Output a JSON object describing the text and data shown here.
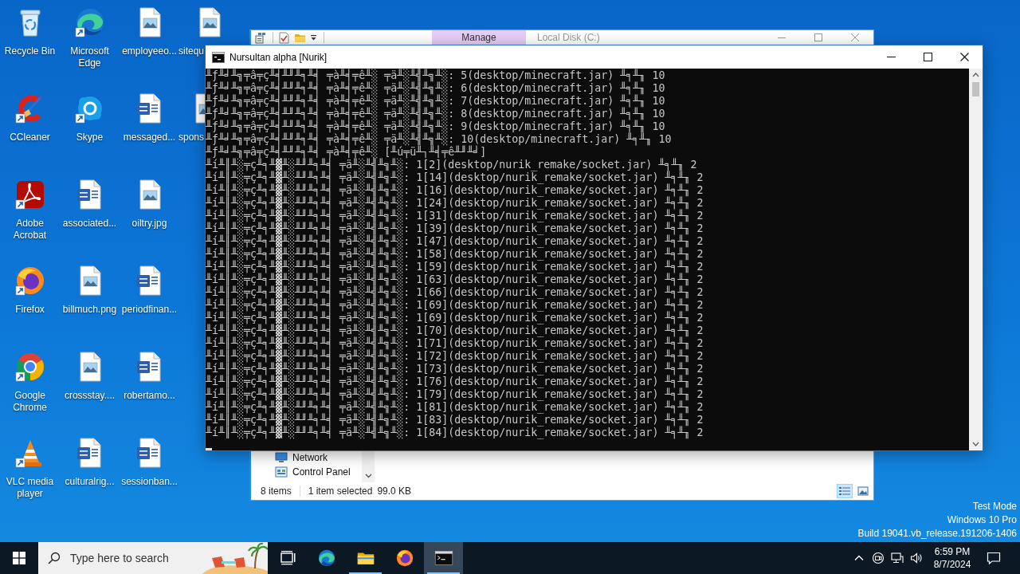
{
  "desktop": {
    "icons": [
      {
        "label": "Recycle Bin",
        "kind": "recycle-bin",
        "shortcut": false
      },
      {
        "label": "CCleaner",
        "kind": "ccleaner",
        "shortcut": true
      },
      {
        "label": "Adobe Acrobat",
        "kind": "acrobat",
        "shortcut": true
      },
      {
        "label": "Firefox",
        "kind": "firefox",
        "shortcut": true
      },
      {
        "label": "Google Chrome",
        "kind": "chrome",
        "shortcut": true
      },
      {
        "label": "VLC media player",
        "kind": "vlc",
        "shortcut": true
      },
      {
        "label": "Microsoft Edge",
        "kind": "edge",
        "shortcut": true
      },
      {
        "label": "Skype",
        "kind": "skype",
        "shortcut": true
      },
      {
        "label": "associated...",
        "kind": "word-doc",
        "shortcut": false
      },
      {
        "label": "billmuch.png",
        "kind": "image-file",
        "shortcut": false
      },
      {
        "label": "crossstay....",
        "kind": "image-file",
        "shortcut": false
      },
      {
        "label": "culturalrig...",
        "kind": "word-doc",
        "shortcut": false
      },
      {
        "label": "employeeo...",
        "kind": "image-file",
        "shortcut": false
      },
      {
        "label": "messaged...",
        "kind": "word-doc",
        "shortcut": false
      },
      {
        "label": "oiltry.jpg",
        "kind": "image-file",
        "shortcut": false
      },
      {
        "label": "periodfinan...",
        "kind": "word-doc",
        "shortcut": false
      },
      {
        "label": "robertamo...",
        "kind": "word-doc",
        "shortcut": false
      },
      {
        "label": "sessionban...",
        "kind": "word-doc",
        "shortcut": false
      },
      {
        "label": "sitequ",
        "kind": "image-file",
        "shortcut": false
      },
      {
        "label": "spons",
        "kind": "image-file",
        "shortcut": false
      }
    ],
    "system_notice": [
      "Test Mode",
      "Windows 10 Pro",
      "Build 19041.vb_release.191206-1406"
    ]
  },
  "explorer_window": {
    "ribbon_tab": "Manage",
    "title": "Local Disk (C:)",
    "nav_items": [
      {
        "label": "Network",
        "kind": "network"
      },
      {
        "label": "Control Panel",
        "kind": "control-panel"
      }
    ],
    "status": {
      "item_count": "8 items",
      "selection": "1 item selected",
      "size": "99.0 KB"
    },
    "view_buttons": [
      {
        "kind": "details",
        "selected": true
      },
      {
        "kind": "large-icons",
        "selected": false
      }
    ]
  },
  "console_window": {
    "title": "Nursultan alpha [Nurik]",
    "lines": [
      "╨ƒ╨╛╨╗╤â╤ç╨╡╨╜╨╕╨╡ ╤à╨╡╤ê╨░ ╤ä╨░╨╣╨╗╨░: 5(desktop/minecraft.jar) ╨╕╨╖ 10",
      "╨ƒ╨╛╨╗╤â╤ç╨╡╨╜╨╕╨╡ ╤à╨╡╤ê╨░ ╤ä╨░╨╣╨╗╨░: 6(desktop/minecraft.jar) ╨╕╨╖ 10",
      "╨ƒ╨╛╨╗╤â╤ç╨╡╨╜╨╕╨╡ ╤à╨╡╤ê╨░ ╤ä╨░╨╣╨╗╨░: 7(desktop/minecraft.jar) ╨╕╨╖ 10",
      "╨ƒ╨╛╨╗╤â╤ç╨╡╨╜╨╕╨╡ ╤à╨╡╤ê╨░ ╤ä╨░╨╣╨╗╨░: 8(desktop/minecraft.jar) ╨╕╨╖ 10",
      "╨ƒ╨╛╨╗╤â╤ç╨╡╨╜╨╕╨╡ ╤à╨╡╤ê╨░ ╤ä╨░╨╣╨╗╨░: 9(desktop/minecraft.jar) ╨╕╨╖ 10",
      "╨ƒ╨╛╨╗╤â╤ç╨╡╨╜╨╕╨╡ ╤à╨╡╤ê╨░ ╤ä╨░╨╣╨╗╨░: 10(desktop/minecraft.jar) ╨╕╨╖ 10",
      "╨ƒ╨╛╨╗╤â╤ç╨╡╨╜╨╕╨╡ ╤à╨╡╤ê╨░ [╨ú╤ü╨┐╨╡╤ê╨╜╨╛]",
      "╨í╨║╨░╤ç╨╕╨▓╨░╨╜╨╕╨╡ ╤ä╨░╨╣╨╗╨░: 1[2](desktop/nurik_remake/socket.jar) ╨╕╨╖ 2",
      "╨í╨║╨░╤ç╨╕╨▓╨░╨╜╨╕╨╡ ╤ä╨░╨╣╨╗╨░: 1[14](desktop/nurik_remake/socket.jar) ╨╕╨╖ 2",
      "╨í╨║╨░╤ç╨╕╨▓╨░╨╜╨╕╨╡ ╤ä╨░╨╣╨╗╨░: 1[16](desktop/nurik_remake/socket.jar) ╨╕╨╖ 2",
      "╨í╨║╨░╤ç╨╕╨▓╨░╨╜╨╕╨╡ ╤ä╨░╨╣╨╗╨░: 1[24](desktop/nurik_remake/socket.jar) ╨╕╨╖ 2",
      "╨í╨║╨░╤ç╨╕╨▓╨░╨╜╨╕╨╡ ╤ä╨░╨╣╨╗╨░: 1[31](desktop/nurik_remake/socket.jar) ╨╕╨╖ 2",
      "╨í╨║╨░╤ç╨╕╨▓╨░╨╜╨╕╨╡ ╤ä╨░╨╣╨╗╨░: 1[39](desktop/nurik_remake/socket.jar) ╨╕╨╖ 2",
      "╨í╨║╨░╤ç╨╕╨▓╨░╨╜╨╕╨╡ ╤ä╨░╨╣╨╗╨░: 1[47](desktop/nurik_remake/socket.jar) ╨╕╨╖ 2",
      "╨í╨║╨░╤ç╨╕╨▓╨░╨╜╨╕╨╡ ╤ä╨░╨╣╨╗╨░: 1[58](desktop/nurik_remake/socket.jar) ╨╕╨╖ 2",
      "╨í╨║╨░╤ç╨╕╨▓╨░╨╜╨╕╨╡ ╤ä╨░╨╣╨╗╨░: 1[59](desktop/nurik_remake/socket.jar) ╨╕╨╖ 2",
      "╨í╨║╨░╤ç╨╕╨▓╨░╨╜╨╕╨╡ ╤ä╨░╨╣╨╗╨░: 1[63](desktop/nurik_remake/socket.jar) ╨╕╨╖ 2",
      "╨í╨║╨░╤ç╨╕╨▓╨░╨╜╨╕╨╡ ╤ä╨░╨╣╨╗╨░: 1[66](desktop/nurik_remake/socket.jar) ╨╕╨╖ 2",
      "╨í╨║╨░╤ç╨╕╨▓╨░╨╜╨╕╨╡ ╤ä╨░╨╣╨╗╨░: 1[69](desktop/nurik_remake/socket.jar) ╨╕╨╖ 2",
      "╨í╨║╨░╤ç╨╕╨▓╨░╨╜╨╕╨╡ ╤ä╨░╨╣╨╗╨░: 1[69](desktop/nurik_remake/socket.jar) ╨╕╨╖ 2",
      "╨í╨║╨░╤ç╨╕╨▓╨░╨╜╨╕╨╡ ╤ä╨░╨╣╨╗╨░: 1[70](desktop/nurik_remake/socket.jar) ╨╕╨╖ 2",
      "╨í╨║╨░╤ç╨╕╨▓╨░╨╜╨╕╨╡ ╤ä╨░╨╣╨╗╨░: 1[71](desktop/nurik_remake/socket.jar) ╨╕╨╖ 2",
      "╨í╨║╨░╤ç╨╕╨▓╨░╨╜╨╕╨╡ ╤ä╨░╨╣╨╗╨░: 1[72](desktop/nurik_remake/socket.jar) ╨╕╨╖ 2",
      "╨í╨║╨░╤ç╨╕╨▓╨░╨╜╨╕╨╡ ╤ä╨░╨╣╨╗╨░: 1[73](desktop/nurik_remake/socket.jar) ╨╕╨╖ 2",
      "╨í╨║╨░╤ç╨╕╨▓╨░╨╜╨╕╨╡ ╤ä╨░╨╣╨╗╨░: 1[76](desktop/nurik_remake/socket.jar) ╨╕╨╖ 2",
      "╨í╨║╨░╤ç╨╕╨▓╨░╨╜╨╕╨╡ ╤ä╨░╨╣╨╗╨░: 1[79](desktop/nurik_remake/socket.jar) ╨╕╨╖ 2",
      "╨í╨║╨░╤ç╨╕╨▓╨░╨╜╨╕╨╡ ╤ä╨░╨╣╨╗╨░: 1[81](desktop/nurik_remake/socket.jar) ╨╕╨╖ 2",
      "╨í╨║╨░╤ç╨╕╨▓╨░╨╜╨╕╨╡ ╤ä╨░╨╣╨╗╨░: 1[83](desktop/nurik_remake/socket.jar) ╨╕╨╖ 2",
      "╨í╨║╨░╤ç╨╕╨▓╨░╨╜╨╕╨╡ ╤ä╨░╨╣╨╗╨░: 1[84](desktop/nurik_remake/socket.jar) ╨╕╨╖ 2"
    ]
  },
  "taskbar": {
    "search": {
      "placeholder": "Type here to search"
    },
    "apps": [
      {
        "kind": "edge",
        "running": false,
        "selected": false
      },
      {
        "kind": "explorer",
        "running": true,
        "selected": false
      },
      {
        "kind": "firefox",
        "running": false,
        "selected": false
      },
      {
        "kind": "console",
        "running": true,
        "selected": true
      }
    ],
    "clock": {
      "time": "6:59 PM",
      "date": "8/7/2024"
    }
  }
}
